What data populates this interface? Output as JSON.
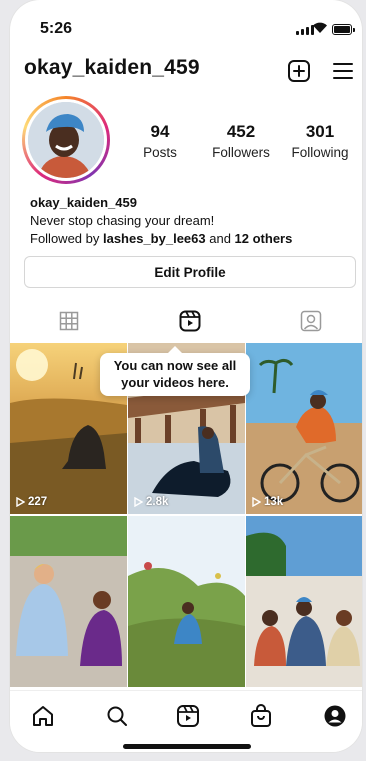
{
  "status": {
    "time": "5:26"
  },
  "header": {
    "username": "okay_kaiden_459"
  },
  "stats": [
    {
      "value": "94",
      "label": "Posts"
    },
    {
      "value": "452",
      "label": "Followers"
    },
    {
      "value": "301",
      "label": "Following"
    }
  ],
  "bio": {
    "name": "okay_kaiden_459",
    "text": "Never stop chasing your dream!",
    "followed_prefix": "Followed by ",
    "followed_user": "lashes_by_lee63",
    "followed_and": " and ",
    "followed_others": "12 others"
  },
  "edit_profile_label": "Edit Profile",
  "tooltip": {
    "line1": "You can now see all",
    "line2": "your videos here."
  },
  "reels": [
    {
      "plays": "227"
    },
    {
      "plays": "2.8k"
    },
    {
      "plays": "13k"
    }
  ],
  "colors": {
    "text": "#111111",
    "border": "#d6d6d6",
    "ring_start": "#f58529",
    "ring_mid": "#dd2a7b"
  }
}
